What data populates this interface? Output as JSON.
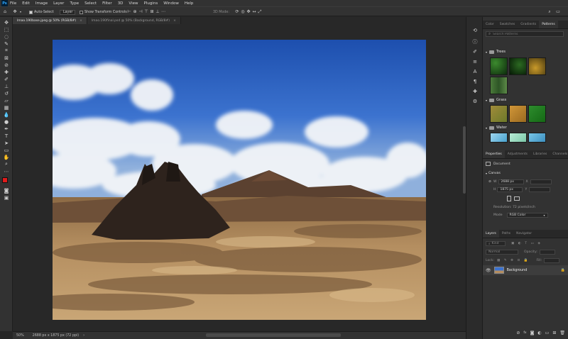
{
  "menubar": {
    "logo": "Ps",
    "items": [
      "File",
      "Edit",
      "Image",
      "Layer",
      "Type",
      "Select",
      "Filter",
      "3D",
      "View",
      "Plugins",
      "Window",
      "Help"
    ]
  },
  "options": {
    "auto_select_label": "Auto-Select",
    "layer_select_value": "Layer",
    "show_transform_label": "Show Transform Controls",
    "mode_3d_label": "3D Mode:"
  },
  "doc_tabs": [
    {
      "label": "lmao.190base.jpeg @ 50% (RGB/8#)",
      "close": "×"
    },
    {
      "label": "lmao.190final.psd @ 50% (Background, RGB/8#)",
      "close": "×"
    }
  ],
  "status": {
    "zoom": "50%",
    "doc_info": "2688 px x 1875 px (72 ppi)",
    "arrow": "›"
  },
  "panels": {
    "top_tabs": [
      "Color",
      "Swatches",
      "Gradients",
      "Patterns"
    ],
    "search_placeholder": "Search Patterns",
    "groups": [
      {
        "name": "Trees"
      },
      {
        "name": "Grass"
      },
      {
        "name": "Water"
      }
    ],
    "mid_tabs": [
      "Properties",
      "Adjustments",
      "Libraries",
      "Channels"
    ],
    "properties": {
      "section": "Document",
      "canvas_label": "Canvas",
      "width": "2688 px",
      "height": "1875 px",
      "x": "X",
      "y": "Y",
      "resolution": "Resolution: 72 pixels/inch",
      "mode_label": "Mode",
      "mode_value": "RGB Color"
    },
    "layer_tabs": [
      "Layers",
      "Paths",
      "Navigator"
    ],
    "layers": {
      "kind": "Kind",
      "blend": "Normal",
      "opacity_label": "Opacity:",
      "lock_label": "Lock:",
      "fill_label": "Fill:",
      "items": [
        {
          "name": "Background"
        }
      ]
    }
  },
  "colors": {
    "foreground": "#e01b1b",
    "background": "#ffffff"
  }
}
